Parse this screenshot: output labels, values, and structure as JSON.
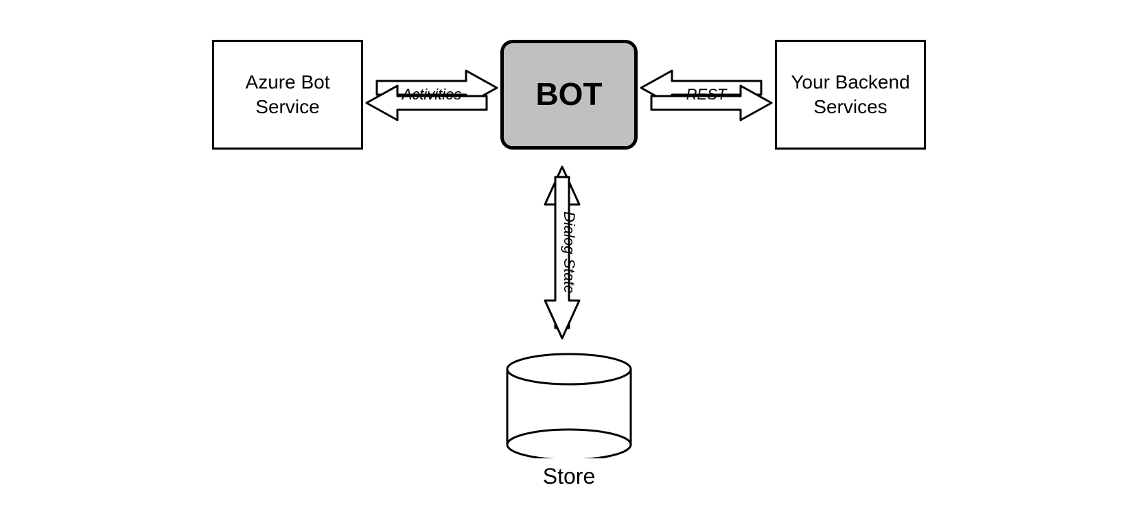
{
  "diagram": {
    "azure_box": {
      "line1": "Azure Bot",
      "line2": "Service"
    },
    "bot_box": {
      "label": "BOT"
    },
    "backend_box": {
      "line1": "Your Backend",
      "line2": "Services"
    },
    "left_arrow_label": "Activities",
    "right_arrow_label": "REST",
    "vertical_arrow_label": "Dialog State",
    "store_label": "Store"
  }
}
